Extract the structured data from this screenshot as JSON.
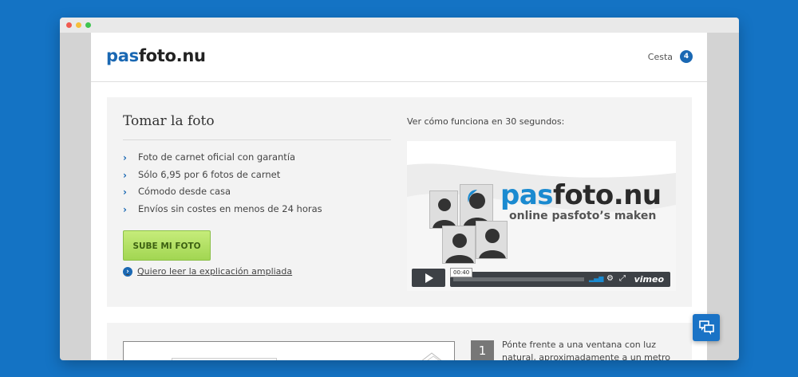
{
  "header": {
    "logo_pas": "pas",
    "logo_rest": "foto.nu",
    "cart_label": "Cesta",
    "cart_count": "4"
  },
  "hero": {
    "title": "Tomar la foto",
    "features": [
      "Foto de carnet oficial con garantía",
      "Sólo 6,95 por 6 fotos de carnet",
      "Cómodo desde casa",
      "Envíos sin costes en menos de 24 horas"
    ],
    "upload_button": "SUBE MI FOTO",
    "more_link": "Quiero leer la explicación ampliada",
    "video_caption": "Ver cómo funciona en 30 segundos:"
  },
  "video": {
    "logo_pas": "pas",
    "logo_rest": "foto.nu",
    "tagline": "online pasfoto’s maken",
    "timecode": "00:40",
    "provider": "vimeo"
  },
  "steps": [
    {
      "number": "1",
      "text": "Pónte frente a una ventana con luz natural, aproximadamente a un metro delante de"
    }
  ],
  "colors": {
    "brand_blue": "#1a68b3",
    "button_green": "#a2d652",
    "background": "#1473c4"
  },
  "icons": {
    "chevron": "chevron-right-icon",
    "cart": "cart-count-badge",
    "chat": "chat-bubbles-icon"
  }
}
